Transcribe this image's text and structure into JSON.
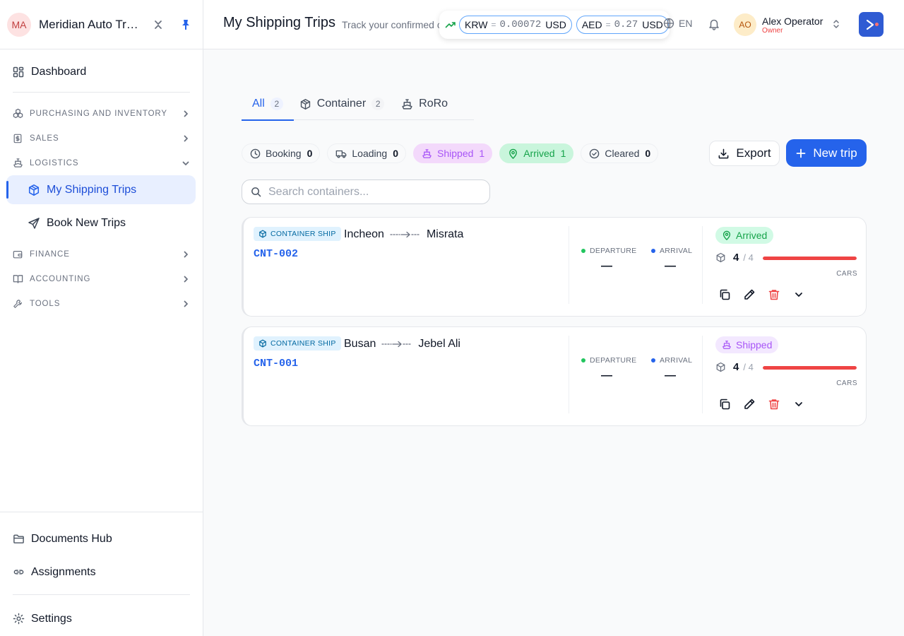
{
  "brand": {
    "initials": "MA",
    "name": "Meridian Auto Trading"
  },
  "nav": {
    "dashboard": "Dashboard",
    "sections": {
      "purchasing": "PURCHASING AND INVENTORY",
      "sales": "SALES",
      "logistics": "LOGISTICS",
      "finance": "FINANCE",
      "accounting": "ACCOUNTING",
      "tools": "TOOLS"
    },
    "logistics_items": [
      "My Shipping Trips",
      "Book New Trips"
    ],
    "bottom": [
      "Documents Hub",
      "Assignments",
      "Settings"
    ]
  },
  "header": {
    "title": "My Shipping Trips",
    "subtitle": "Track your confirmed containers",
    "rates": [
      {
        "currency": "KRW",
        "value": "0.00072",
        "unit": "USD"
      },
      {
        "currency": "AED",
        "value": "0.27",
        "unit": "USD"
      }
    ],
    "language": "EN",
    "user": {
      "initials": "AO",
      "name": "Alex Operator",
      "role": "Owner"
    }
  },
  "tabs": [
    {
      "label": "All",
      "count": "2",
      "active": true
    },
    {
      "label": "Container",
      "count": "2"
    },
    {
      "label": "RoRo",
      "count": ""
    }
  ],
  "filters": [
    {
      "label": "Booking",
      "count": "0"
    },
    {
      "label": "Loading",
      "count": "0"
    },
    {
      "label": "Shipped",
      "count": "1"
    },
    {
      "label": "Arrived",
      "count": "1"
    },
    {
      "label": "Cleared",
      "count": "0"
    }
  ],
  "actions": {
    "export": "Export",
    "new_trip": "New trip"
  },
  "search": {
    "placeholder": "Search containers..."
  },
  "trips": [
    {
      "type": "CONTAINER SHIP",
      "origin": "Incheon",
      "destination": "Misrata",
      "id": "CNT-002",
      "departure_label": "DEPARTURE",
      "departure": "—",
      "arrival_label": "ARRIVAL",
      "arrival": "—",
      "status": "Arrived",
      "cars_loaded": "4",
      "cars_total": "/ 4",
      "cars_label": "CARS",
      "progress": 1.0
    },
    {
      "type": "CONTAINER SHIP",
      "origin": "Busan",
      "destination": "Jebel Ali",
      "id": "CNT-001",
      "departure_label": "DEPARTURE",
      "departure": "—",
      "arrival_label": "ARRIVAL",
      "arrival": "—",
      "status": "Shipped",
      "cars_loaded": "4",
      "cars_total": "/ 4",
      "cars_label": "CARS",
      "progress": 1.0
    }
  ],
  "colors": {
    "accent": "#2563eb",
    "arrived": "#16a34a",
    "shipped": "#a855f7",
    "progress": "#ef4444",
    "departure_dot": "#22c55e",
    "arrival_dot": "#2563eb"
  }
}
